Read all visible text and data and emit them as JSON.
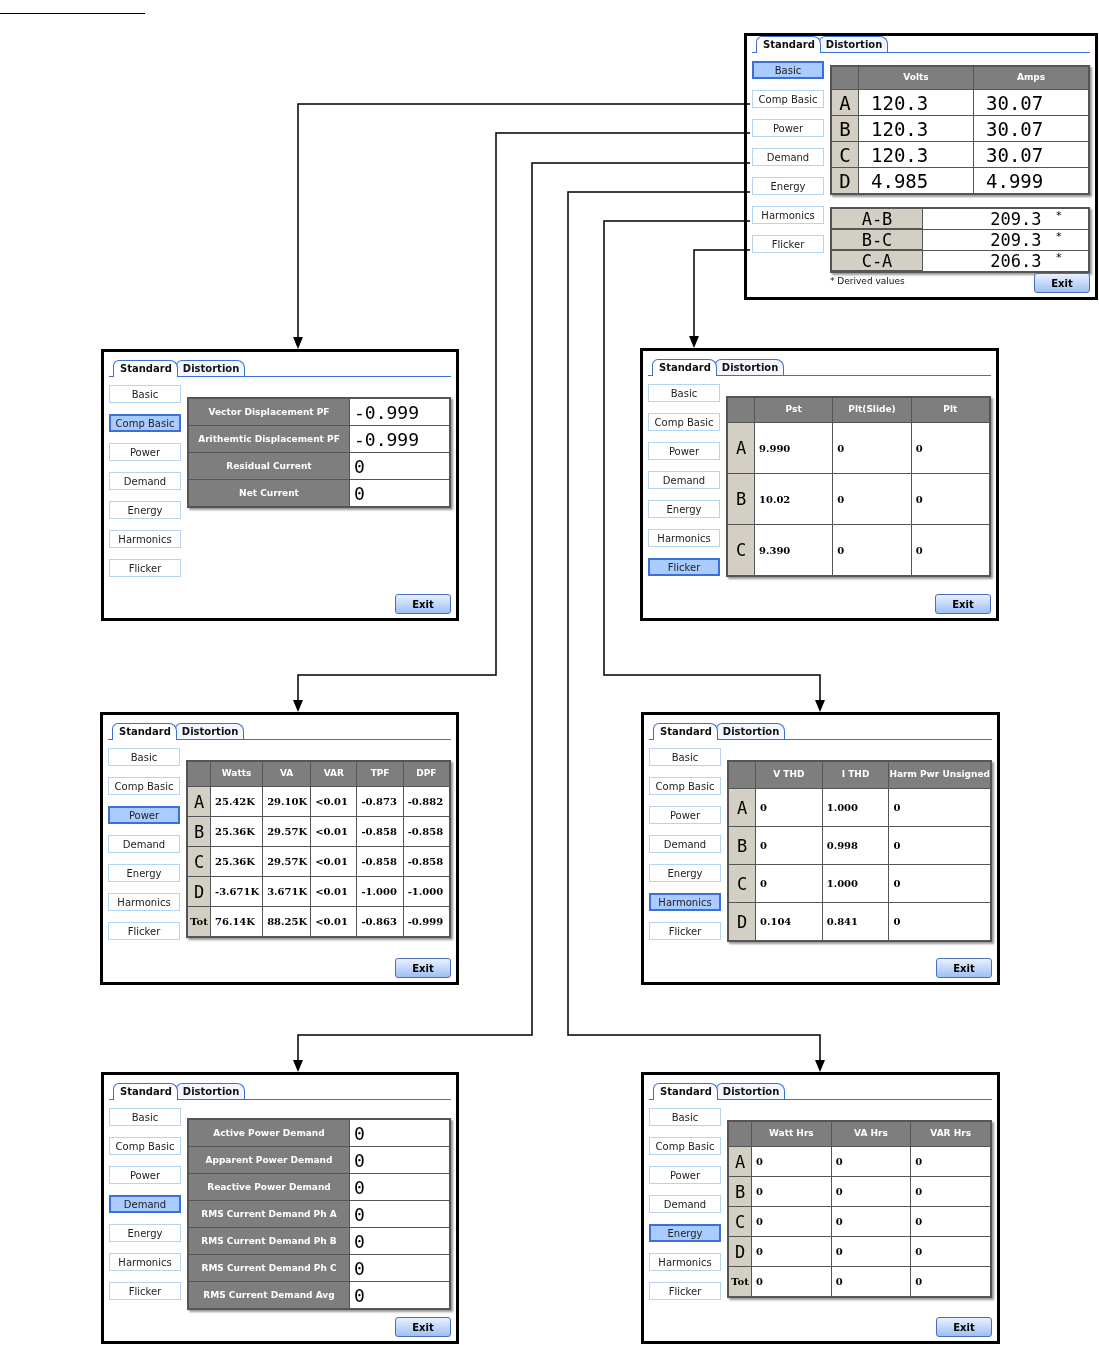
{
  "screens": [
    {
      "tabs": [
        {
          "label": "Standard",
          "selected": true
        },
        {
          "label": "Distortion",
          "selected": false
        }
      ],
      "nav": [
        {
          "label": "Basic",
          "selected": true
        },
        {
          "label": "Comp Basic",
          "selected": false
        },
        {
          "label": "Power",
          "selected": false
        },
        {
          "label": "Demand",
          "selected": false
        },
        {
          "label": "Energy",
          "selected": false
        },
        {
          "label": "Harmonics",
          "selected": false
        },
        {
          "label": "Flicker",
          "selected": false
        }
      ],
      "content": {
        "kind": "phase_table",
        "columns": [
          "Volts",
          "Amps"
        ],
        "rows": [
          {
            "phase": "A",
            "cells": [
              "120.3",
              "30.07"
            ]
          },
          {
            "phase": "B",
            "cells": [
              "120.3",
              "30.07"
            ]
          },
          {
            "phase": "C",
            "cells": [
              "120.3",
              "30.07"
            ]
          },
          {
            "phase": "D",
            "cells": [
              "4.985",
              "4.999"
            ]
          }
        ]
      },
      "line_table": {
        "rows": [
          {
            "label": "A-B",
            "value": "209.3",
            "mark": "*"
          },
          {
            "label": "B-C",
            "value": "209.3",
            "mark": "*"
          },
          {
            "label": "C-A",
            "value": "206.3",
            "mark": "*"
          }
        ]
      },
      "footnote": "* Derived values",
      "exit": "Exit"
    },
    {
      "tabs": [
        {
          "label": "Standard",
          "selected": true
        },
        {
          "label": "Distortion",
          "selected": false
        }
      ],
      "nav": [
        {
          "label": "Basic",
          "selected": false
        },
        {
          "label": "Comp Basic",
          "selected": true
        },
        {
          "label": "Power",
          "selected": false
        },
        {
          "label": "Demand",
          "selected": false
        },
        {
          "label": "Energy",
          "selected": false
        },
        {
          "label": "Harmonics",
          "selected": false
        },
        {
          "label": "Flicker",
          "selected": false
        }
      ],
      "content": {
        "kind": "value_list",
        "rows": [
          {
            "label": "Vector Displacement PF",
            "value": "-0.999"
          },
          {
            "label": "Arithemtic Displacement PF",
            "value": "-0.999"
          },
          {
            "label": "Residual Current",
            "value": "0"
          },
          {
            "label": "Net Current",
            "value": "0"
          }
        ]
      },
      "exit": "Exit"
    },
    {
      "tabs": [
        {
          "label": "Standard",
          "selected": true
        },
        {
          "label": "Distortion",
          "selected": false
        }
      ],
      "nav": [
        {
          "label": "Basic",
          "selected": false
        },
        {
          "label": "Comp Basic",
          "selected": false
        },
        {
          "label": "Power",
          "selected": false
        },
        {
          "label": "Demand",
          "selected": false
        },
        {
          "label": "Energy",
          "selected": false
        },
        {
          "label": "Harmonics",
          "selected": false
        },
        {
          "label": "Flicker",
          "selected": true
        }
      ],
      "content": {
        "kind": "phase_table",
        "columns": [
          "Pst",
          "Plt(Slide)",
          "Plt"
        ],
        "rows": [
          {
            "phase": "A",
            "cells": [
              "9.990",
              "0",
              "0"
            ]
          },
          {
            "phase": "B",
            "cells": [
              "10.02",
              "0",
              "0"
            ]
          },
          {
            "phase": "C",
            "cells": [
              "9.390",
              "0",
              "0"
            ]
          }
        ]
      },
      "exit": "Exit"
    },
    {
      "tabs": [
        {
          "label": "Standard",
          "selected": true
        },
        {
          "label": "Distortion",
          "selected": false
        }
      ],
      "nav": [
        {
          "label": "Basic",
          "selected": false
        },
        {
          "label": "Comp Basic",
          "selected": false
        },
        {
          "label": "Power",
          "selected": true
        },
        {
          "label": "Demand",
          "selected": false
        },
        {
          "label": "Energy",
          "selected": false
        },
        {
          "label": "Harmonics",
          "selected": false
        },
        {
          "label": "Flicker",
          "selected": false
        }
      ],
      "content": {
        "kind": "phase_table",
        "columns": [
          "Watts",
          "VA",
          "VAR",
          "TPF",
          "DPF"
        ],
        "rows": [
          {
            "phase": "A",
            "cells": [
              "25.42K",
              "29.10K",
              "<0.01",
              "-0.873",
              "-0.882"
            ]
          },
          {
            "phase": "B",
            "cells": [
              "25.36K",
              "29.57K",
              "<0.01",
              "-0.858",
              "-0.858"
            ]
          },
          {
            "phase": "C",
            "cells": [
              "25.36K",
              "29.57K",
              "<0.01",
              "-0.858",
              "-0.858"
            ]
          },
          {
            "phase": "D",
            "cells": [
              "-3.671K",
              "3.671K",
              "<0.01",
              "-1.000",
              "-1.000"
            ]
          },
          {
            "phase": "Tot",
            "cells": [
              "76.14K",
              "88.25K",
              "<0.01",
              "-0.863",
              "-0.999"
            ]
          }
        ]
      },
      "exit": "Exit"
    },
    {
      "tabs": [
        {
          "label": "Standard",
          "selected": true
        },
        {
          "label": "Distortion",
          "selected": false
        }
      ],
      "nav": [
        {
          "label": "Basic",
          "selected": false
        },
        {
          "label": "Comp Basic",
          "selected": false
        },
        {
          "label": "Power",
          "selected": false
        },
        {
          "label": "Demand",
          "selected": false
        },
        {
          "label": "Energy",
          "selected": false
        },
        {
          "label": "Harmonics",
          "selected": true
        },
        {
          "label": "Flicker",
          "selected": false
        }
      ],
      "content": {
        "kind": "phase_table",
        "columns": [
          "V THD",
          "I THD",
          "Harm Pwr Unsigned"
        ],
        "rows": [
          {
            "phase": "A",
            "cells": [
              "0",
              "1.000",
              "0"
            ]
          },
          {
            "phase": "B",
            "cells": [
              "0",
              "0.998",
              "0"
            ]
          },
          {
            "phase": "C",
            "cells": [
              "0",
              "1.000",
              "0"
            ]
          },
          {
            "phase": "D",
            "cells": [
              "0.104",
              "0.841",
              "0"
            ]
          }
        ]
      },
      "exit": "Exit"
    },
    {
      "tabs": [
        {
          "label": "Standard",
          "selected": true
        },
        {
          "label": "Distortion",
          "selected": false
        }
      ],
      "nav": [
        {
          "label": "Basic",
          "selected": false
        },
        {
          "label": "Comp Basic",
          "selected": false
        },
        {
          "label": "Power",
          "selected": false
        },
        {
          "label": "Demand",
          "selected": true
        },
        {
          "label": "Energy",
          "selected": false
        },
        {
          "label": "Harmonics",
          "selected": false
        },
        {
          "label": "Flicker",
          "selected": false
        }
      ],
      "content": {
        "kind": "value_list",
        "rows": [
          {
            "label": "Active Power Demand",
            "value": "0"
          },
          {
            "label": "Apparent Power Demand",
            "value": "0"
          },
          {
            "label": "Reactive Power Demand",
            "value": "0"
          },
          {
            "label": "RMS Current Demand Ph A",
            "value": "0"
          },
          {
            "label": "RMS Current Demand Ph B",
            "value": "0"
          },
          {
            "label": "RMS Current Demand Ph C",
            "value": "0"
          },
          {
            "label": "RMS Current Demand Avg",
            "value": "0"
          }
        ]
      },
      "exit": "Exit"
    },
    {
      "tabs": [
        {
          "label": "Standard",
          "selected": true
        },
        {
          "label": "Distortion",
          "selected": false
        }
      ],
      "nav": [
        {
          "label": "Basic",
          "selected": false
        },
        {
          "label": "Comp Basic",
          "selected": false
        },
        {
          "label": "Power",
          "selected": false
        },
        {
          "label": "Demand",
          "selected": false
        },
        {
          "label": "Energy",
          "selected": true
        },
        {
          "label": "Harmonics",
          "selected": false
        },
        {
          "label": "Flicker",
          "selected": false
        }
      ],
      "content": {
        "kind": "phase_table",
        "columns": [
          "Watt Hrs",
          "VA Hrs",
          "VAR Hrs"
        ],
        "rows": [
          {
            "phase": "A",
            "cells": [
              "0",
              "0",
              "0"
            ]
          },
          {
            "phase": "B",
            "cells": [
              "0",
              "0",
              "0"
            ]
          },
          {
            "phase": "C",
            "cells": [
              "0",
              "0",
              "0"
            ]
          },
          {
            "phase": "D",
            "cells": [
              "0",
              "0",
              "0"
            ]
          },
          {
            "phase": "Tot",
            "cells": [
              "0",
              "0",
              "0"
            ]
          }
        ]
      },
      "exit": "Exit"
    }
  ]
}
